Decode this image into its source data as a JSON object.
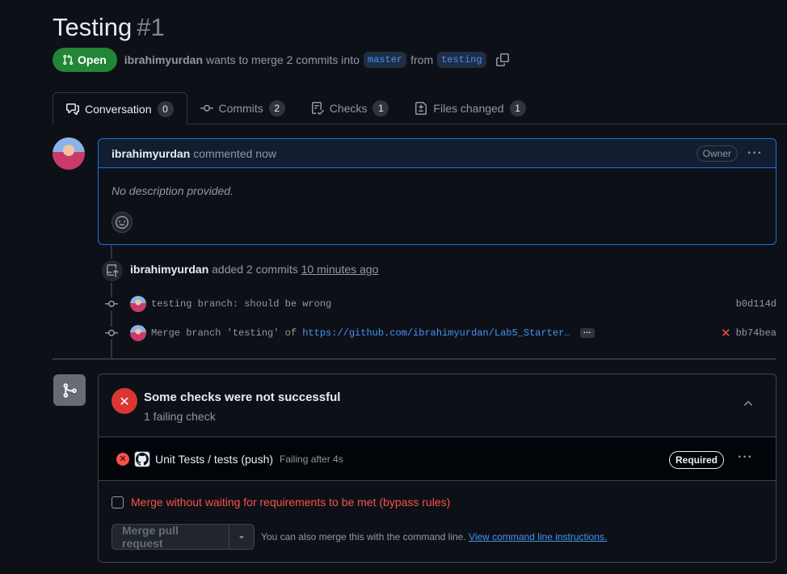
{
  "pr": {
    "title": "Testing",
    "number": "#1",
    "state": "Open",
    "author": "ibrahimyurdan",
    "meta_text": "wants to merge 2 commits into",
    "base_branch": "master",
    "from_text": "from",
    "head_branch": "testing"
  },
  "tabs": [
    {
      "label": "Conversation",
      "count": "0",
      "icon": "comment-discussion-icon"
    },
    {
      "label": "Commits",
      "count": "2",
      "icon": "git-commit-icon"
    },
    {
      "label": "Checks",
      "count": "1",
      "icon": "checklist-icon"
    },
    {
      "label": "Files changed",
      "count": "1",
      "icon": "file-diff-icon"
    }
  ],
  "comment": {
    "author": "ibrahimyurdan",
    "action": "commented now",
    "role": "Owner",
    "body": "No description provided."
  },
  "timeline": {
    "author": "ibrahimyurdan",
    "action": "added 2 commits",
    "when": "10 minutes ago",
    "commits": [
      {
        "message": "testing branch: should be wrong",
        "sha": "b0d114d",
        "failed": false
      },
      {
        "message": "Merge branch 'testing' of",
        "link": "https://github.com/ibrahimyurdan/Lab5_Starter…",
        "more": "…",
        "sha": "bb74bea",
        "failed": true
      }
    ]
  },
  "merge_box": {
    "title": "Some checks were not successful",
    "subtitle": "1 failing check",
    "check": {
      "name": "Unit Tests / tests (push)",
      "status": "Failing after 4s",
      "badge": "Required"
    },
    "bypass_label": "Merge without waiting for requirements to be met (bypass rules)",
    "merge_button": "Merge pull request",
    "cli_text": "You can also merge this with the command line.",
    "cli_link": "View command line instructions."
  },
  "colors": {
    "background": "#0d1117",
    "open_green": "#238636",
    "accent_blue": "#4493f8",
    "danger_red": "#f85149"
  }
}
